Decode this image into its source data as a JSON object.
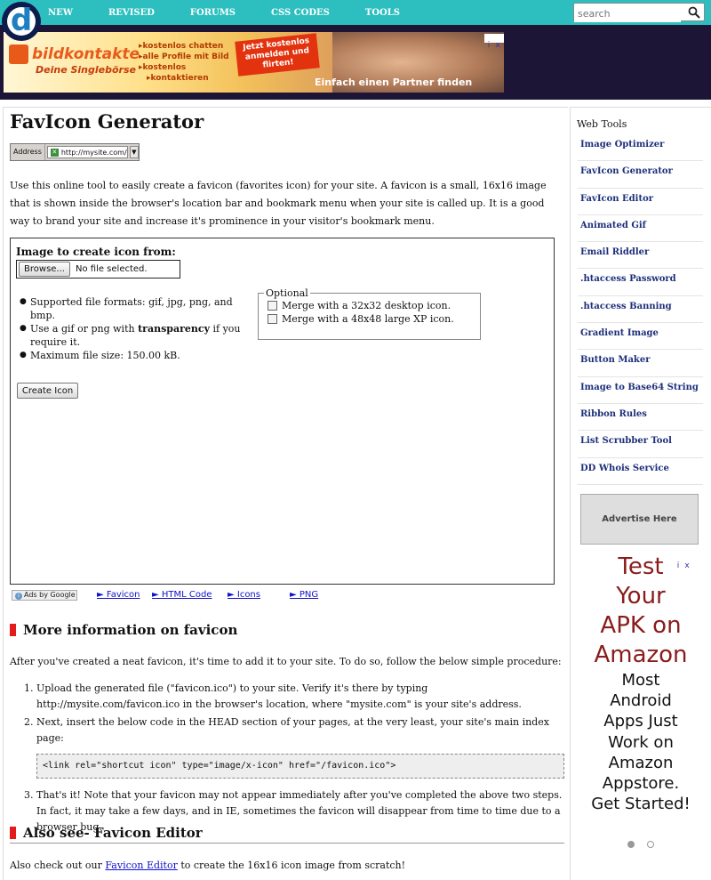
{
  "header": {
    "logo_letter": "d",
    "nav": [
      "NEW",
      "REVISED",
      "FORUMS",
      "CSS CODES",
      "TOOLS"
    ],
    "search_placeholder": "search"
  },
  "banner_ad": {
    "brand": "bildkontakte",
    "brand_sub": "Deine Singlebörse",
    "bullets": [
      "kostenlos chatten",
      "alle Profile mit Bild",
      "kostenlos",
      "kontaktieren"
    ],
    "cta": "Jetzt kostenlos anmelden und flirten!",
    "tagline": "Einfach einen Partner finden",
    "adchoices": [
      "i",
      "x"
    ]
  },
  "main": {
    "title": "FavIcon Generator",
    "address_demo": {
      "label": "Address",
      "url": "http://mysite.com/",
      "dropdown": "▼"
    },
    "intro": "Use this online tool to easily create a favicon (favorites icon) for your site. A favicon is a small, 16x16 image that is shown inside the browser's location bar and bookmark menu when your site is called up. It is a good way to brand your site and increase it's prominence in your visitor's bookmark menu.",
    "tool": {
      "image_label": "Image to create icon from:",
      "browse_label": "Browse...",
      "no_file": "No file selected.",
      "rules": [
        "Supported file formats: gif, jpg, png, and bmp.",
        "Use a gif or png with",
        "transparency",
        "if you require it.",
        "Maximum file size: 150.00 kB."
      ],
      "optional_legend": "Optional",
      "options": [
        "Merge with a 32x32 desktop icon.",
        "Merge with a 48x48 large XP icon."
      ],
      "create_label": "Create Icon"
    },
    "ads_line": {
      "adsby": "Ads by Google",
      "links": [
        "► Favicon",
        "► HTML Code",
        "► Icons",
        "► PNG"
      ]
    },
    "more_info": {
      "heading": "More information on favicon",
      "lead": "After you've created a neat favicon, it's time to add it to your site. To do so, follow the below simple procedure:",
      "step1": "Upload the generated file (\"favicon.ico\") to your site. Verify it's there by typing http://mysite.com/favicon.ico in the browser's location, where \"mysite.com\" is your site's address.",
      "step2": "Next, insert the below code in the HEAD section of your pages, at the very least, your site's main index page:",
      "code": "<link rel=\"shortcut icon\" type=\"image/x-icon\" href=\"/favicon.ico\">",
      "step3": "That's it! Note that your favicon may not appear immediately after you've completed the above two steps. In fact, it may take a few days, and in IE, sometimes the favicon will disappear from time to time due to a browser bug."
    },
    "also_see": {
      "heading": "Also see- Favicon Editor",
      "text_before": "Also check out our",
      "link": "Favicon Editor",
      "text_after": "to create the 16x16 icon image from scratch!"
    }
  },
  "sidebar": {
    "heading": "Web Tools",
    "tools": [
      "Image Optimizer",
      "FavIcon Generator",
      "FavIcon Editor",
      "Animated Gif",
      "Email Riddler",
      ".htaccess Password",
      ".htaccess Banning",
      "Gradient Image",
      "Button Maker",
      "Image to Base64 String",
      "Ribbon Rules",
      "List Scrubber Tool",
      "DD Whois Service"
    ],
    "advertise": "Advertise Here",
    "apk_ad": {
      "big": [
        "Test",
        "Your",
        "APK on",
        "Amazon"
      ],
      "small": [
        "Most",
        "Android",
        "Apps Just",
        "Work on",
        "Amazon",
        "Appstore.",
        "Get Started!"
      ],
      "adchoices": [
        "i",
        "x"
      ]
    }
  },
  "colors": {
    "topbar": "#2dbfbf",
    "banner_bg": "#1c1535",
    "heading_marker": "#e41b1b",
    "sidebar_link": "#1d2f7a",
    "ad_headline": "#8a1c1c"
  }
}
